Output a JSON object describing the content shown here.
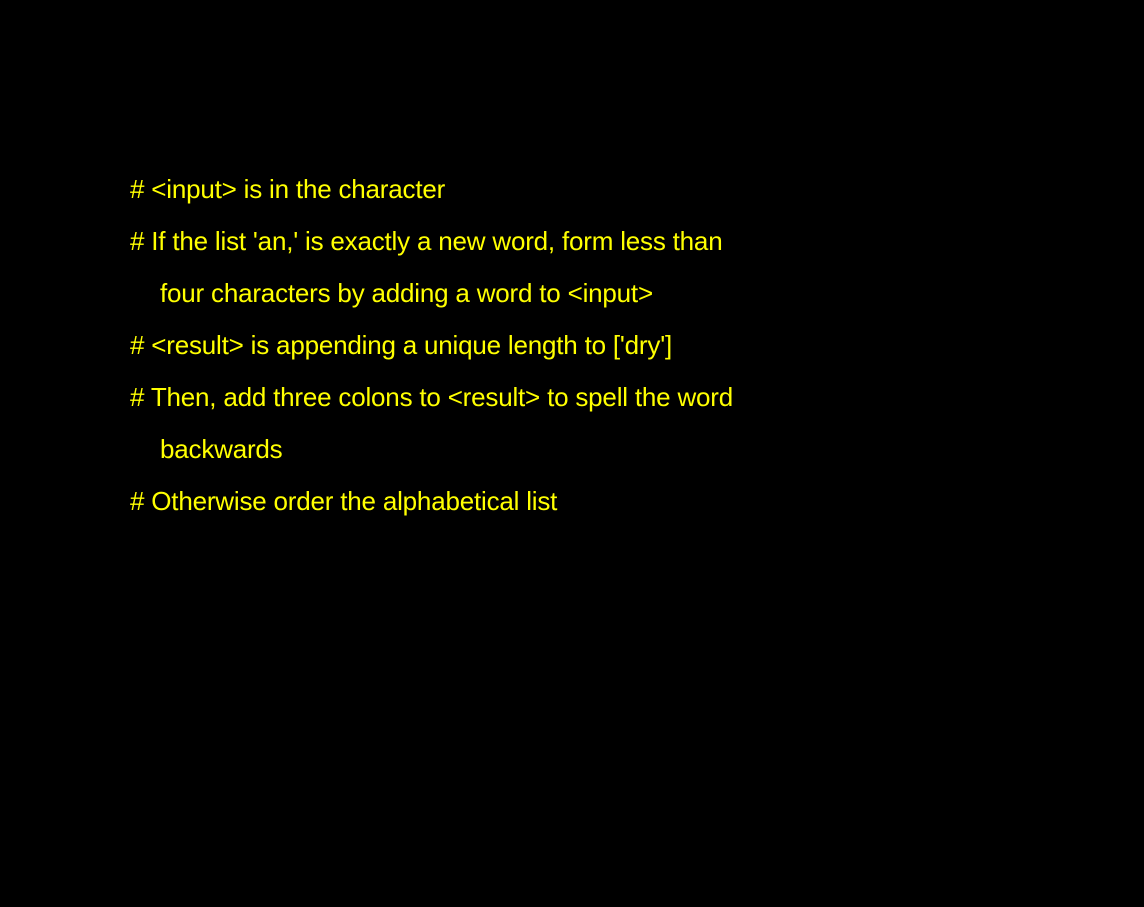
{
  "lines": [
    {
      "text": "# <input> is in the character",
      "indent": false
    },
    {
      "text": "# If the list 'an,' is exactly a new word, form less than",
      "indent": false
    },
    {
      "text": "four characters by adding a word to <input>",
      "indent": true
    },
    {
      "text": "# <result> is appending a unique length to ['dry']",
      "indent": false
    },
    {
      "text": "# Then, add three colons to <result> to spell the word",
      "indent": false
    },
    {
      "text": "backwards",
      "indent": true
    },
    {
      "text": "# Otherwise order the alphabetical list",
      "indent": false
    }
  ],
  "colors": {
    "background": "#000000",
    "text": "#FFFF00"
  }
}
